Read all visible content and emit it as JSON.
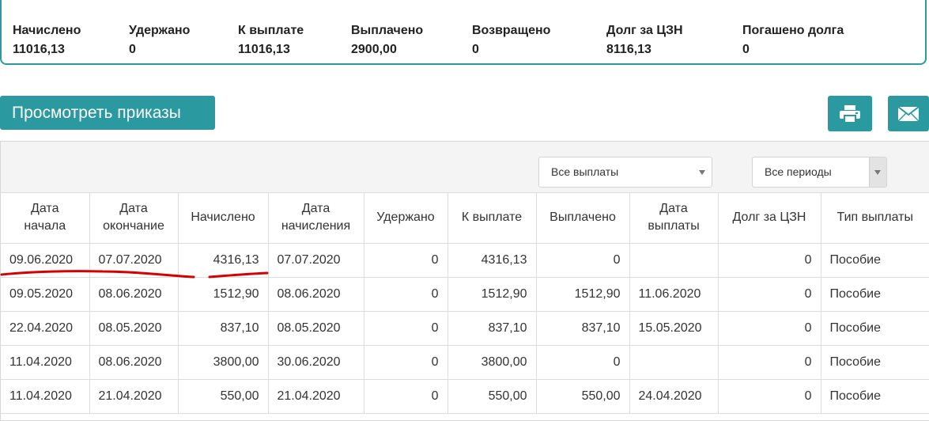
{
  "summary": {
    "items": [
      {
        "label": "Начислено",
        "value": "11016,13"
      },
      {
        "label": "Удержано",
        "value": "0"
      },
      {
        "label": "К выплате",
        "value": "11016,13"
      },
      {
        "label": "Выплачено",
        "value": "2900,00"
      },
      {
        "label": "Возвращено",
        "value": "0"
      },
      {
        "label": "Долг за ЦЗН",
        "value": "8116,13"
      },
      {
        "label": "Погашено долга",
        "value": "0"
      }
    ]
  },
  "toolbar": {
    "orders_button": "Просмотреть приказы",
    "print_icon": "printer-icon",
    "mail_icon": "envelope-icon",
    "accent_color": "#2b9aa0"
  },
  "filters": {
    "payments_select": "Все выплаты",
    "periods_select": "Все периоды"
  },
  "table": {
    "headers": [
      [
        "Дата",
        "начала"
      ],
      [
        "Дата",
        "окончание"
      ],
      [
        "Начислено"
      ],
      [
        "Дата",
        "начисления"
      ],
      [
        "Удержано"
      ],
      [
        "К выплате"
      ],
      [
        "Выплачено"
      ],
      [
        "Дата",
        "выплаты"
      ],
      [
        "Долг за ЦЗН"
      ],
      [
        "Тип выплаты"
      ]
    ],
    "rows": [
      [
        "09.06.2020",
        "07.07.2020",
        "4316,13",
        "07.07.2020",
        "0",
        "4316,13",
        "0",
        "",
        "0",
        "Пособие"
      ],
      [
        "09.05.2020",
        "08.06.2020",
        "1512,90",
        "08.06.2020",
        "0",
        "1512,90",
        "1512,90",
        "11.06.2020",
        "0",
        "Пособие"
      ],
      [
        "22.04.2020",
        "08.05.2020",
        "837,10",
        "08.05.2020",
        "0",
        "837,10",
        "837,10",
        "15.05.2020",
        "0",
        "Пособие"
      ],
      [
        "11.04.2020",
        "08.06.2020",
        "3800,00",
        "30.06.2020",
        "0",
        "3800,00",
        "0",
        "",
        "0",
        "Пособие"
      ],
      [
        "11.04.2020",
        "21.04.2020",
        "550,00",
        "21.04.2020",
        "0",
        "550,00",
        "550,00",
        "24.04.2020",
        "0",
        "Пособие"
      ]
    ]
  }
}
